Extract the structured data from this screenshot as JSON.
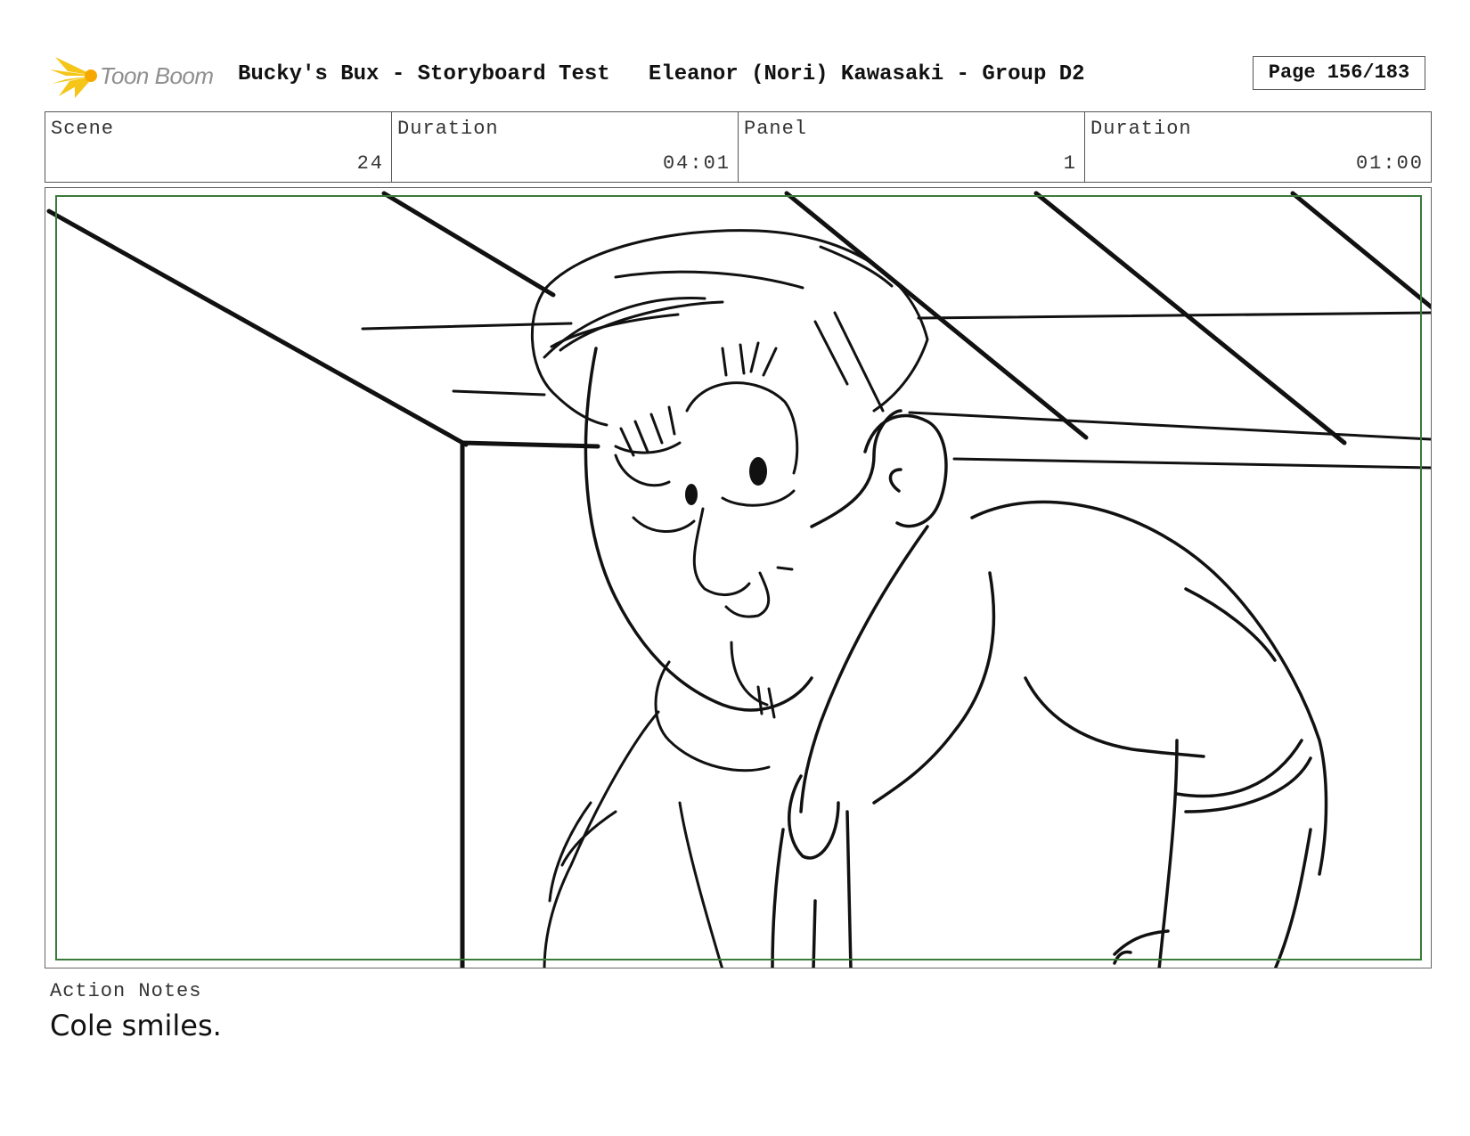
{
  "header": {
    "logo_text": "Toon Boom",
    "project_title": "Bucky's Bux - Storyboard Test",
    "author": "Eleanor (Nori) Kawasaki - Group D2",
    "page": "Page 156/183"
  },
  "info": {
    "scene_label": "Scene",
    "scene_value": "24",
    "scene_duration_label": "Duration",
    "scene_duration_value": "04:01",
    "panel_label": "Panel",
    "panel_value": "1",
    "panel_duration_label": "Duration",
    "panel_duration_value": "01:00"
  },
  "notes": {
    "label": "Action Notes",
    "text": "Cole smiles."
  },
  "colors": {
    "safe_frame": "#3a7a3a",
    "logo_yellow": "#f5c518"
  }
}
